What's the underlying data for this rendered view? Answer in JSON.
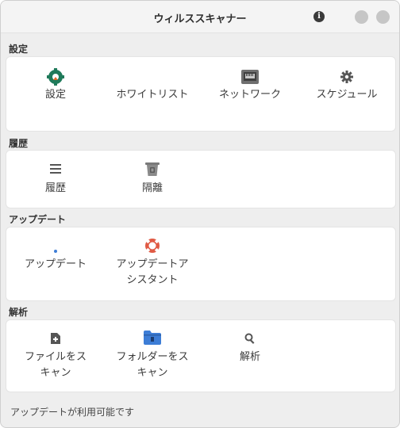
{
  "window": {
    "title": "ウィルススキャナー"
  },
  "sections": {
    "settings": {
      "title": "設定",
      "items": [
        {
          "label": "設定",
          "icon": "gear-settings-icon"
        },
        {
          "label": "ホワイトリスト",
          "icon": "whitelist-icon"
        },
        {
          "label": "ネットワーク",
          "icon": "network-port-icon"
        },
        {
          "label": "スケジュール",
          "icon": "cog-icon"
        }
      ]
    },
    "history": {
      "title": "履歴",
      "items": [
        {
          "label": "履歴",
          "icon": "list-icon"
        },
        {
          "label": "隔離",
          "icon": "trash-quarantine-icon"
        }
      ]
    },
    "update": {
      "title": "アップデート",
      "items": [
        {
          "label": "アップデート",
          "icon": "update-dot-icon"
        },
        {
          "label_line1": "アップデートア",
          "label_line2": "シスタント",
          "icon": "lifebuoy-icon"
        }
      ]
    },
    "analysis": {
      "title": "解析",
      "items": [
        {
          "label_line1": "ファイルをス",
          "label_line2": "キャン",
          "icon": "file-add-icon"
        },
        {
          "label_line1": "フォルダーをス",
          "label_line2": "キャン",
          "icon": "folder-icon"
        },
        {
          "label": "解析",
          "icon": "magnifier-icon"
        }
      ]
    }
  },
  "status": "アップデートが利用可能です",
  "colors": {
    "accent_green": "#1f7a5a",
    "lifebuoy_red": "#e05a44",
    "folder_blue": "#3d7dd6"
  }
}
